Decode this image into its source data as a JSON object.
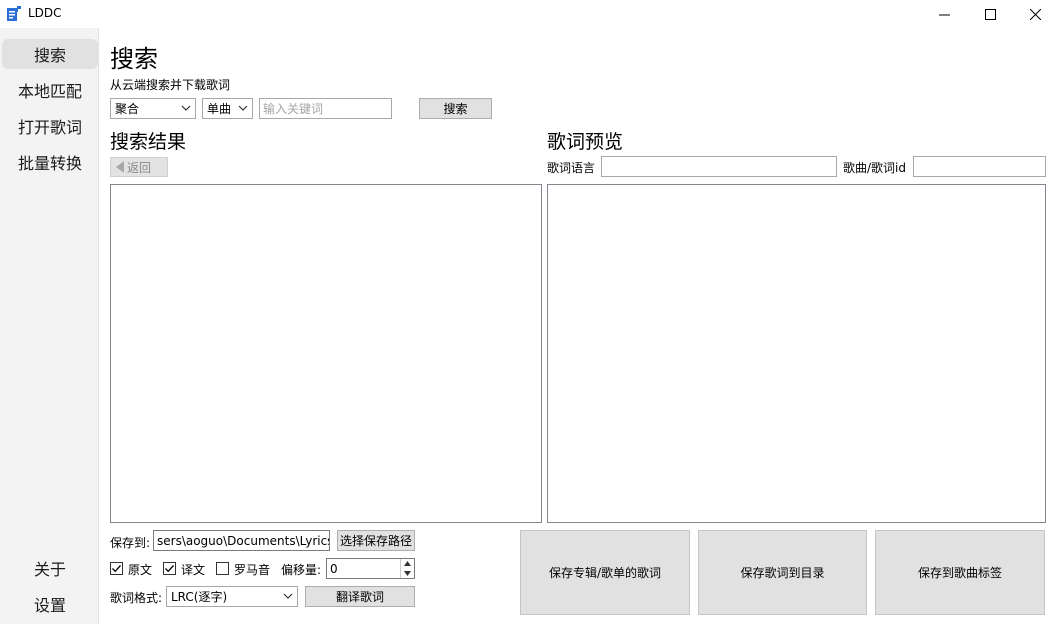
{
  "window": {
    "title": "LDDC"
  },
  "sidebar": {
    "items": [
      {
        "label": "搜索"
      },
      {
        "label": "本地匹配"
      },
      {
        "label": "打开歌词"
      },
      {
        "label": "批量转换"
      }
    ],
    "bottom_items": [
      {
        "label": "关于"
      },
      {
        "label": "设置"
      }
    ]
  },
  "page": {
    "title": "搜索",
    "subtitle": "从云端搜索并下载歌词"
  },
  "search": {
    "source_value": "聚合",
    "type_value": "单曲",
    "keyword_placeholder": "输入关键词",
    "search_button": "搜索"
  },
  "results": {
    "title": "搜索结果",
    "back_label": "返回"
  },
  "preview": {
    "title": "歌词预览",
    "lang_label": "歌词语言",
    "lang_value": "",
    "id_label": "歌曲/歌词id",
    "id_value": ""
  },
  "bottom": {
    "save_to_label": "保存到:",
    "save_path": "sers\\aoguo\\Documents\\Lyrics",
    "choose_path_button": "选择保存路径",
    "original_label": "原文",
    "original_checked": true,
    "translation_label": "译文",
    "translation_checked": true,
    "romaji_label": "罗马音",
    "romaji_checked": false,
    "offset_label": "偏移量:",
    "offset_value": "0",
    "format_label": "歌词格式:",
    "format_value": "LRC(逐字)",
    "translate_button": "翻译歌词",
    "save_album_button": "保存专辑/歌单的歌词",
    "save_dir_button": "保存歌词到目录",
    "save_tag_button": "保存到歌曲标签"
  }
}
